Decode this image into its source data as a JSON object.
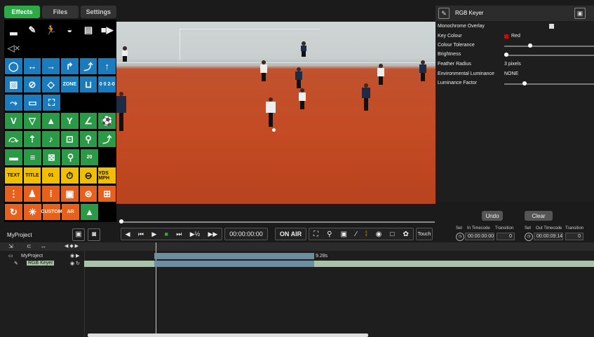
{
  "tabs": [
    "Effects",
    "Files",
    "Settings"
  ],
  "palette": {
    "zone_label": "ZONE",
    "score_label": "0 0 2-0",
    "text_label": "TEXT",
    "title_label": "TITLE",
    "counter_label": "01",
    "speed_label": "YDS MPH",
    "custom_label": "CUSTOM",
    "ar_label": "AR",
    "twenty_label": "20"
  },
  "properties": {
    "effect_title": "RGB Keyer",
    "rows": [
      {
        "label": "Monochrome Overlay",
        "value": ""
      },
      {
        "label": "Key Colour",
        "value": "Red"
      },
      {
        "label": "Colour Tolerance",
        "value": ""
      },
      {
        "label": "Brightness",
        "value": ""
      },
      {
        "label": "Feather Radius",
        "value": "3 pixels"
      },
      {
        "label": "Environmental Luminance",
        "value": "NONE"
      },
      {
        "label": "Luminance Factor",
        "value": ""
      }
    ],
    "key_colour_hex": "#e00000",
    "undo": "Undo",
    "clear": "Clear"
  },
  "project": {
    "name": "MyProject"
  },
  "transport": {
    "timecode": "00:00:00:00",
    "on_air": "ON AIR",
    "touch": "Touch"
  },
  "in_out": {
    "set_label": "Set",
    "in_label": "In Timecode",
    "out_label": "Out Timecode",
    "transition_label": "Transition",
    "in_timecode": "00:00:00:00",
    "in_transition": "0",
    "out_timecode": "00:00:09:14",
    "out_transition": "0"
  },
  "timeline": {
    "tracks": [
      {
        "name": "MyProject",
        "clip_label": "9.28s"
      },
      {
        "name": "RGB Keyer",
        "clip_label": ""
      }
    ]
  }
}
